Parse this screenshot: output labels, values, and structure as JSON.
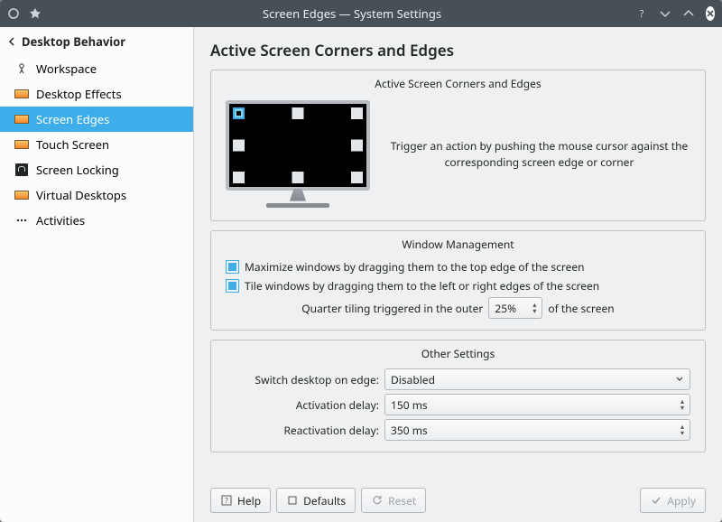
{
  "window": {
    "title": "Screen Edges — System Settings"
  },
  "sidebar": {
    "breadcrumb": "Desktop Behavior",
    "items": [
      {
        "label": "Workspace"
      },
      {
        "label": "Desktop Effects"
      },
      {
        "label": "Screen Edges"
      },
      {
        "label": "Touch Screen"
      },
      {
        "label": "Screen Locking"
      },
      {
        "label": "Virtual Desktops"
      },
      {
        "label": "Activities"
      }
    ]
  },
  "main": {
    "title": "Active Screen Corners and Edges",
    "edges_group_title": "Active Screen Corners and Edges",
    "edge_description": "Trigger an action by pushing the mouse cursor against the corresponding screen edge or corner",
    "wm_group_title": "Window Management",
    "maximize_label": "Maximize windows by dragging them to the top edge of the screen",
    "tile_label": "Tile windows by dragging them to the left or right edges of the screen",
    "quarter_prefix": "Quarter tiling triggered in the outer",
    "quarter_value": "25%",
    "quarter_suffix": "of the screen",
    "other_group_title": "Other Settings",
    "switch_label": "Switch desktop on edge:",
    "switch_value": "Disabled",
    "activation_label": "Activation delay:",
    "activation_value": "150 ms",
    "reactivation_label": "Reactivation delay:",
    "reactivation_value": "350 ms"
  },
  "footer": {
    "help": "Help",
    "defaults": "Defaults",
    "reset": "Reset",
    "apply": "Apply"
  }
}
